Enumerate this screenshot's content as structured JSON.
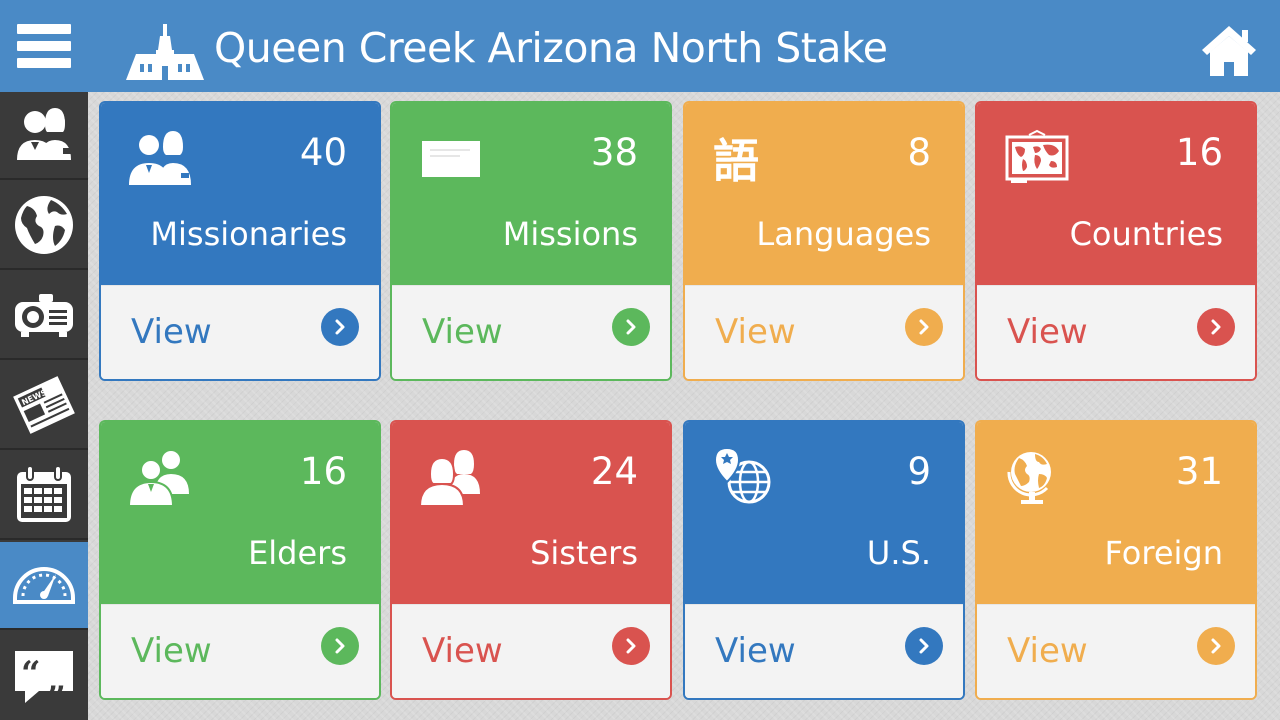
{
  "header": {
    "title": "Queen Creek Arizona North Stake"
  },
  "colors": {
    "blue": "#3378bf",
    "green": "#5cb85c",
    "orange": "#f0ad4e",
    "red": "#d9534f",
    "header": "#4a8ac6",
    "sidebar": "#3a3a3a"
  },
  "sidebar": {
    "items": [
      {
        "icon": "people-icon"
      },
      {
        "icon": "globe-icon"
      },
      {
        "icon": "projector-icon"
      },
      {
        "icon": "news-icon"
      },
      {
        "icon": "calendar-icon"
      },
      {
        "icon": "dashboard-icon"
      },
      {
        "icon": "quote-icon"
      }
    ]
  },
  "cards": [
    {
      "count": "40",
      "label": "Missionaries",
      "view": "View",
      "icon": "missionaries-icon",
      "color": "blue"
    },
    {
      "count": "38",
      "label": "Missions",
      "view": "View",
      "icon": "missions-icon",
      "color": "green"
    },
    {
      "count": "8",
      "label": "Languages",
      "view": "View",
      "icon": "languages-icon",
      "color": "orange"
    },
    {
      "count": "16",
      "label": "Countries",
      "view": "View",
      "icon": "countries-map-icon",
      "color": "red"
    },
    {
      "count": "16",
      "label": "Elders",
      "view": "View",
      "icon": "elders-icon",
      "color": "green"
    },
    {
      "count": "24",
      "label": "Sisters",
      "view": "View",
      "icon": "sisters-icon",
      "color": "red"
    },
    {
      "count": "9",
      "label": "U.S.",
      "view": "View",
      "icon": "us-globe-pin-icon",
      "color": "blue"
    },
    {
      "count": "31",
      "label": "Foreign",
      "view": "View",
      "icon": "foreign-globe-icon",
      "color": "orange"
    }
  ]
}
